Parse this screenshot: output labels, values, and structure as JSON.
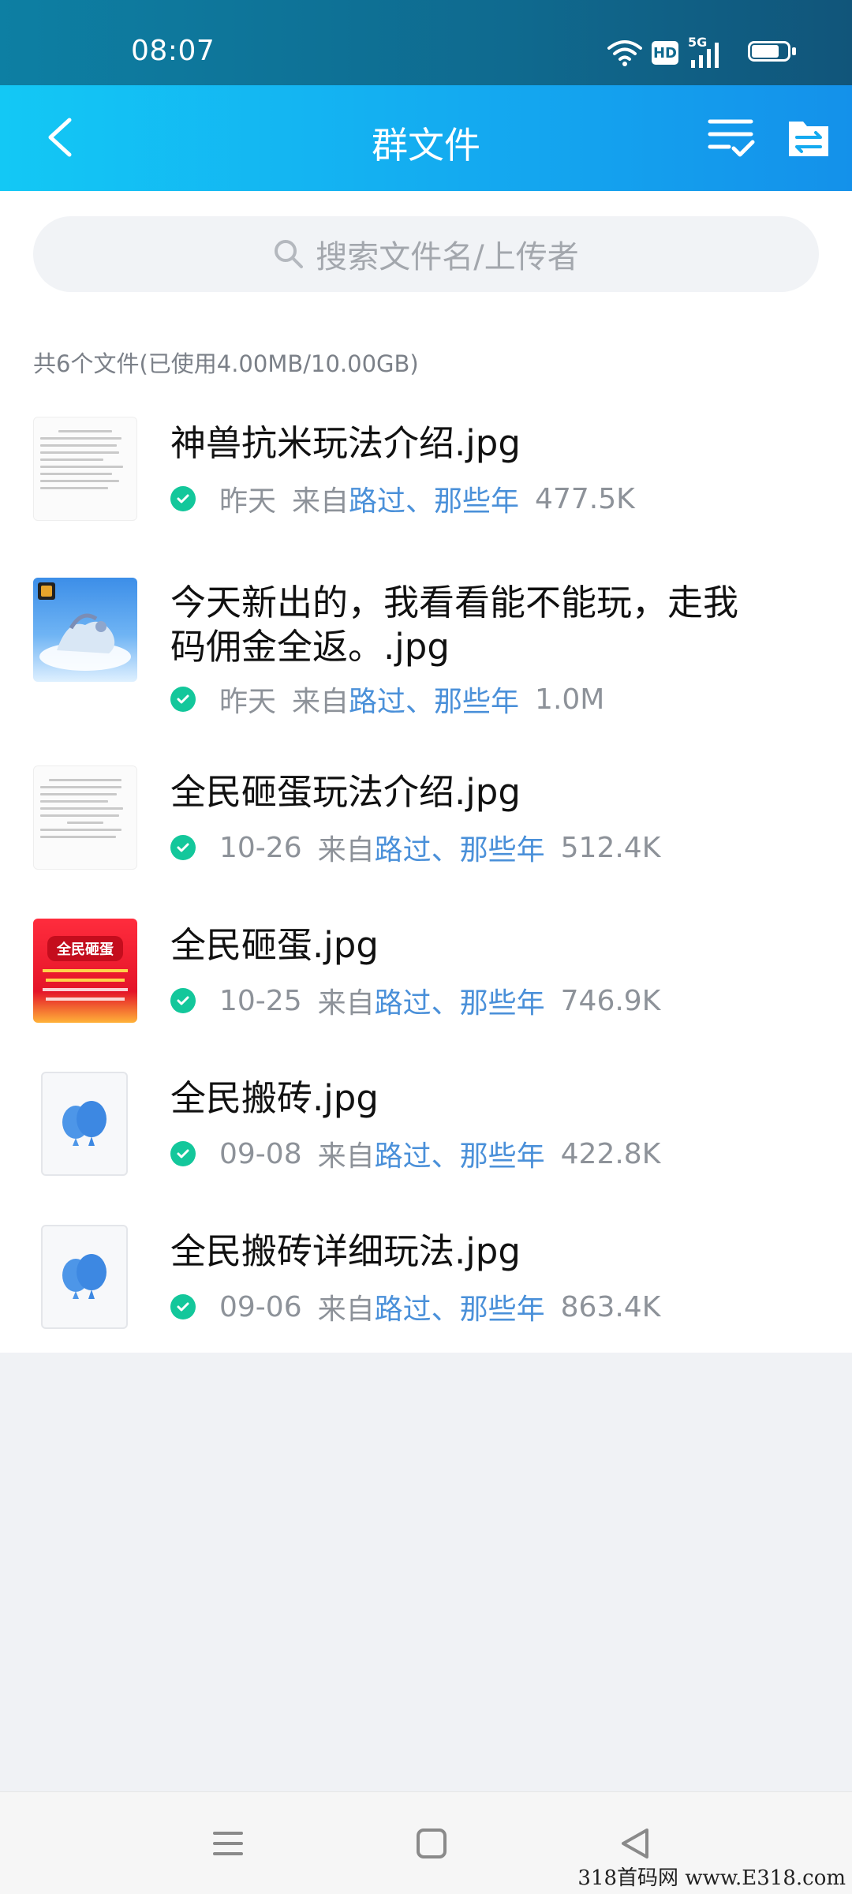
{
  "status_bar": {
    "time": "08:07",
    "icons": [
      "wifi-icon",
      "hd-icon",
      "5g-signal-icon",
      "battery-icon"
    ],
    "hd_label": "HD",
    "network_label": "5G"
  },
  "header": {
    "title": "群文件",
    "icons": [
      "back-arrow-icon",
      "sort-list-icon",
      "file-transfer-icon"
    ]
  },
  "search": {
    "placeholder": "搜索文件名/上传者"
  },
  "summary": "共6个文件(已使用4.00MB/10.00GB)",
  "files": [
    {
      "name": "神兽抗米玩法介绍.jpg",
      "date": "昨天",
      "from_label": "来自",
      "uploader": "路过、那些年",
      "size": "477.5K",
      "thumb": "document"
    },
    {
      "name": "今天新出的，我看看能不能玩，走我码佣金全返。.jpg",
      "date": "昨天",
      "from_label": "来自",
      "uploader": "路过、那些年",
      "size": "1.0M",
      "thumb": "image-blue"
    },
    {
      "name": "全民砸蛋玩法介绍.jpg",
      "date": "10-26",
      "from_label": "来自",
      "uploader": "路过、那些年",
      "size": "512.4K",
      "thumb": "document"
    },
    {
      "name": "全民砸蛋.jpg",
      "date": "10-25",
      "from_label": "来自",
      "uploader": "路过、那些年",
      "size": "746.9K",
      "thumb": "image-red",
      "thumb_text": "全民砸蛋"
    },
    {
      "name": "全民搬砖.jpg",
      "date": "09-08",
      "from_label": "来自",
      "uploader": "路过、那些年",
      "size": "422.8K",
      "thumb": "generic"
    },
    {
      "name": "全民搬砖详细玩法.jpg",
      "date": "09-06",
      "from_label": "来自",
      "uploader": "路过、那些年",
      "size": "863.4K",
      "thumb": "generic"
    }
  ],
  "bottom_nav": {
    "icons": [
      "menu-icon",
      "home-icon",
      "back-icon"
    ]
  },
  "watermark": "318首码网 www.E318.com",
  "colors": {
    "header_start": "#13c8f5",
    "header_end": "#1491ea",
    "check": "#13c79b",
    "uploader_link": "#4a90d9"
  }
}
